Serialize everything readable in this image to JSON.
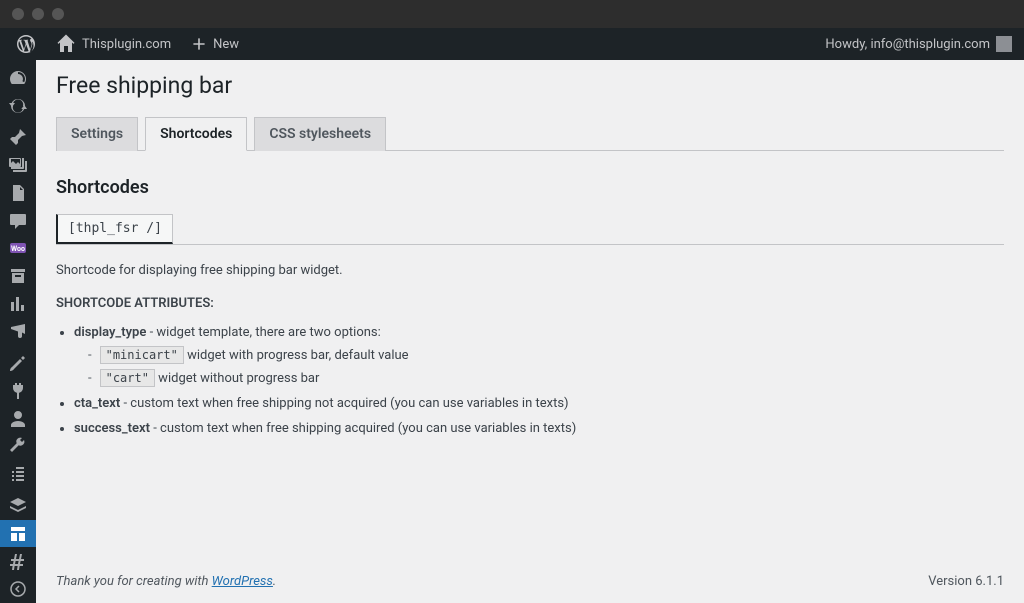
{
  "adminbar": {
    "site_name": "Thisplugin.com",
    "new_label": "New",
    "howdy": "Howdy, info@thisplugin.com"
  },
  "page": {
    "title": "Free shipping bar"
  },
  "tabs": [
    {
      "label": "Settings",
      "active": false
    },
    {
      "label": "Shortcodes",
      "active": true
    },
    {
      "label": "CSS stylesheets",
      "active": false
    }
  ],
  "section": {
    "heading": "Shortcodes",
    "shortcode": "[thpl_fsr /]",
    "description": "Shortcode for displaying free shipping bar widget.",
    "attr_heading": "SHORTCODE ATTRIBUTES:",
    "attrs": {
      "display_type": {
        "name": "display_type",
        "desc": " - widget template, there are two options:",
        "opts": [
          {
            "code": "\"minicart\"",
            "desc": " widget with progress bar, default value"
          },
          {
            "code": "\"cart\"",
            "desc": " widget without progress bar"
          }
        ]
      },
      "cta_text": {
        "name": "cta_text",
        "desc": " - custom text when free shipping not acquired (you can use variables in texts)"
      },
      "success_text": {
        "name": "success_text",
        "desc": " - custom text when free shipping acquired (you can use variables in texts)"
      }
    }
  },
  "footer": {
    "thank_pre": "Thank you for creating with ",
    "wp_link": "WordPress",
    "thank_post": ".",
    "version": "Version 6.1.1"
  }
}
